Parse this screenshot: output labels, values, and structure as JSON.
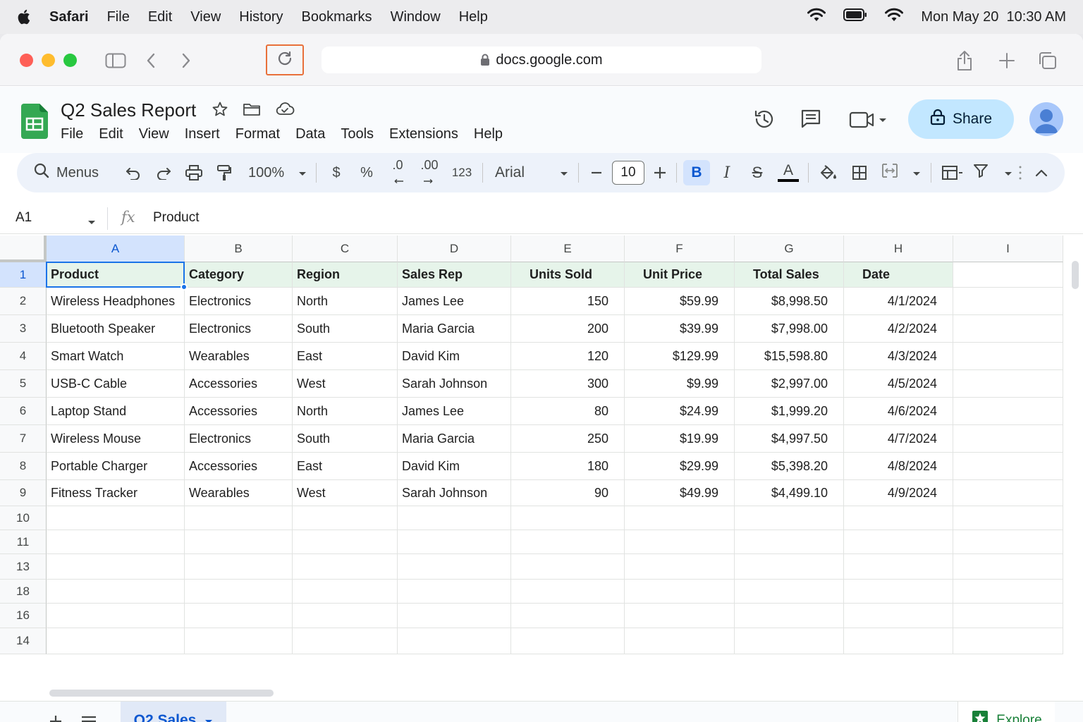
{
  "menubar": {
    "app": "Safari",
    "items": [
      "File",
      "Edit",
      "View",
      "History",
      "Bookmarks",
      "Window",
      "Help"
    ],
    "clock": "Mon May 20  10:30 AM"
  },
  "browser": {
    "url": "docs.google.com"
  },
  "doc": {
    "title": "Q2 Sales Report",
    "menu": [
      "File",
      "Edit",
      "View",
      "Insert",
      "Format",
      "Data",
      "Tools",
      "Extensions",
      "Help"
    ],
    "share_label": "Share"
  },
  "toolbar": {
    "menus_label": "Menus",
    "zoom": "100%",
    "currency": "$",
    "percent": "%",
    "dec_decrease": ".0",
    "dec_increase": ".00",
    "number_format": "123",
    "font": "Arial",
    "font_size": "10",
    "bold": "B",
    "italic": "I",
    "strike": "S",
    "text_color": "A"
  },
  "formula": {
    "cell_ref": "A1",
    "fx": "fx",
    "value": "Product"
  },
  "grid": {
    "columns": [
      "A",
      "B",
      "C",
      "D",
      "E",
      "F",
      "G",
      "H",
      "I"
    ],
    "row_numbers": [
      "1",
      "2",
      "3",
      "4",
      "5",
      "6",
      "7",
      "8",
      "9",
      "10",
      "11",
      "13",
      "18",
      "16",
      "14"
    ],
    "header": [
      "Product",
      "Category",
      "Region",
      "Sales Rep",
      "Units Sold",
      "Unit Price",
      "Total Sales",
      "Date"
    ],
    "rows": [
      [
        "Wireless Headphones",
        "Electronics",
        "North",
        "James Lee",
        "150",
        "$59.99",
        "$8,998.50",
        "4/1/2024"
      ],
      [
        "Bluetooth Speaker",
        "Electronics",
        "South",
        "Maria Garcia",
        "200",
        "$39.99",
        "$7,998.00",
        "4/2/2024"
      ],
      [
        "Smart Watch",
        "Wearables",
        "East",
        "David Kim",
        "120",
        "$129.99",
        "$15,598.80",
        "4/3/2024"
      ],
      [
        "USB-C Cable",
        "Accessories",
        "West",
        "Sarah Johnson",
        "300",
        "$9.99",
        "$2,997.00",
        "4/5/2024"
      ],
      [
        "Laptop Stand",
        "Accessories",
        "North",
        "James Lee",
        "80",
        "$24.99",
        "$1,999.20",
        "4/6/2024"
      ],
      [
        "Wireless Mouse",
        "Electronics",
        "South",
        "Maria Garcia",
        "250",
        "$19.99",
        "$4,997.50",
        "4/7/2024"
      ],
      [
        "Portable Charger",
        "Accessories",
        "East",
        "David Kim",
        "180",
        "$29.99",
        "$5,398.20",
        "4/8/2024"
      ],
      [
        "Fitness Tracker",
        "Wearables",
        "West",
        "Sarah Johnson",
        "90",
        "$49.99",
        "$4,499.10",
        "4/9/2024"
      ]
    ]
  },
  "tabs": {
    "active": "Q2 Sales",
    "explore": "Explore"
  }
}
